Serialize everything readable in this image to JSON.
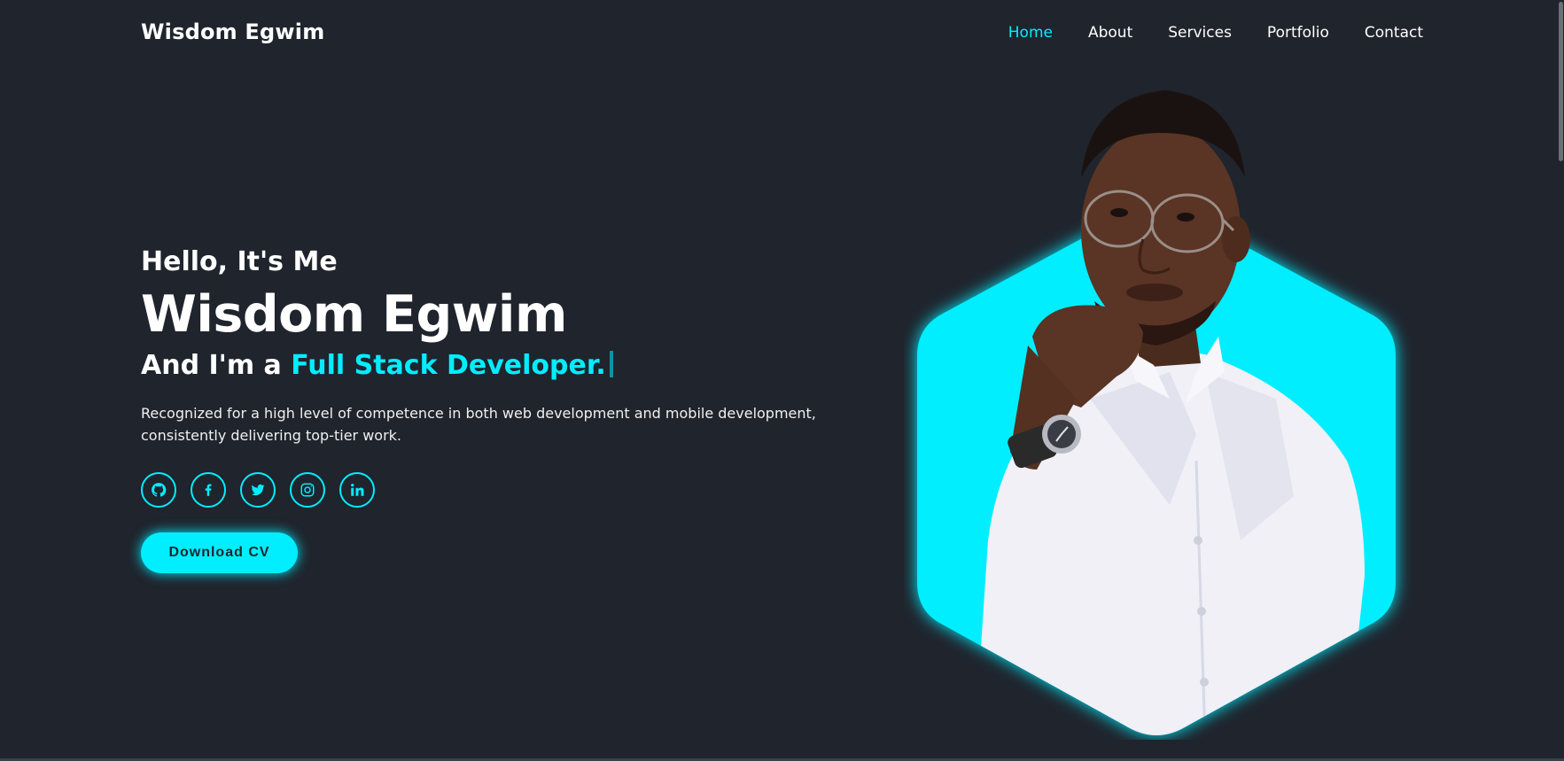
{
  "header": {
    "logo": "Wisdom Egwim",
    "nav": [
      "Home",
      "About",
      "Services",
      "Portfolio",
      "Contact"
    ],
    "active": "Home"
  },
  "home": {
    "hello": "Hello, It's Me",
    "name": "Wisdom Egwim",
    "role_prefix": "And I'm a",
    "role_highlight": "Full Stack Developer.",
    "description": "Recognized for a high level of competence in both web development and mobile development, consistently delivering top-tier work.",
    "social": [
      "github-icon",
      "facebook-icon",
      "twitter-icon",
      "instagram-icon",
      "linkedin-icon"
    ],
    "cta": "Download CV"
  },
  "colors": {
    "background": "#1f242d",
    "accent": "#00eeff",
    "text": "#ffffff"
  }
}
